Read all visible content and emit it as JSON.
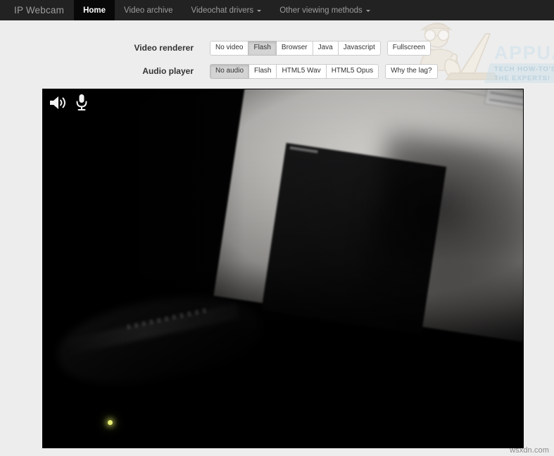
{
  "navbar": {
    "brand": "IP Webcam",
    "items": [
      {
        "label": "Home",
        "active": true,
        "caret": false
      },
      {
        "label": "Video archive",
        "active": false,
        "caret": false
      },
      {
        "label": "Videochat drivers",
        "active": false,
        "caret": true
      },
      {
        "label": "Other viewing methods",
        "active": false,
        "caret": true
      }
    ]
  },
  "controls": {
    "video_renderer": {
      "label": "Video renderer",
      "primary_group": [
        "No video",
        "Flash",
        "Browser",
        "Java",
        "Javascript"
      ],
      "active": "Flash",
      "secondary_group": [
        "Fullscreen"
      ]
    },
    "audio_player": {
      "label": "Audio player",
      "primary_group": [
        "No audio",
        "Flash",
        "HTML5 Wav",
        "HTML5 Opus"
      ],
      "active": "No audio",
      "secondary_group": [
        "Why the lag?"
      ]
    }
  },
  "video": {
    "speaker_icon": "speaker-icon",
    "microphone_icon": "microphone-icon"
  },
  "watermark": {
    "title": "APPUALS",
    "tagline_line1": "TECH HOW-TO'S FROM",
    "tagline_line2": "THE EXPERTS!"
  },
  "footer": {
    "credit": "wsxdn.com"
  },
  "colors": {
    "navbar_bg": "#222222",
    "navbar_active_bg": "#080808",
    "navbar_text": "#9d9d9d",
    "page_bg": "#ededed",
    "button_bg": "#ffffff",
    "button_active_bg": "#d4d4d4",
    "button_border": "#cccccc",
    "label_text": "#333333",
    "video_bg": "#000000",
    "watermark_blue": "#bcd9e8",
    "led_green": "#e8ee72"
  }
}
